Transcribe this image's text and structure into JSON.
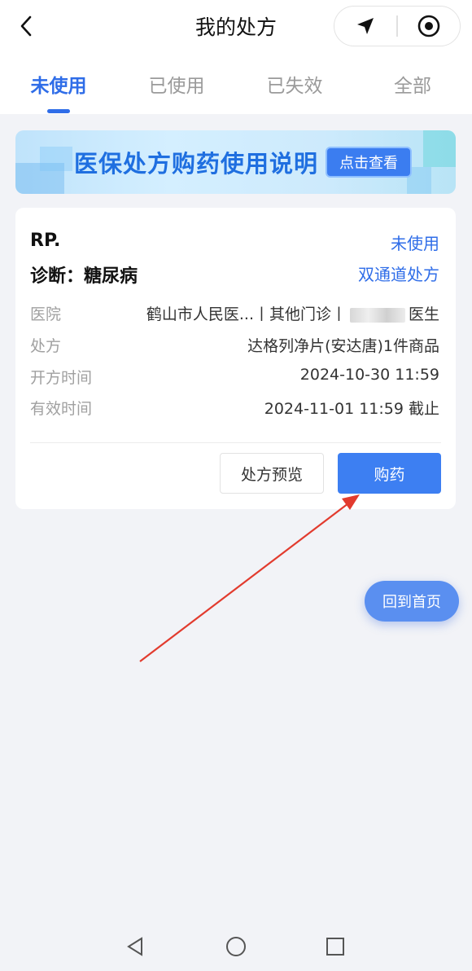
{
  "header": {
    "title": "我的处方",
    "back_icon": "chevron-left-icon",
    "capsule_icons": [
      "navigation-arrow-icon",
      "target-circle-icon"
    ]
  },
  "tabs": [
    {
      "label": "未使用",
      "active": true
    },
    {
      "label": "已使用",
      "active": false
    },
    {
      "label": "已失效",
      "active": false
    },
    {
      "label": "全部",
      "active": false
    }
  ],
  "banner": {
    "text": "医保处方购药使用说明",
    "button_label": "点击查看"
  },
  "card": {
    "rp": "RP.",
    "status": "未使用",
    "diagnosis": "诊断：糖尿病",
    "channel": "双通道处方",
    "rows": [
      {
        "label": "医院",
        "value_pre": "鹤山市人民医...丨其他门诊丨",
        "value_post": "医生"
      },
      {
        "label": "处方",
        "value": "达格列净片(安达唐)1件商品"
      },
      {
        "label": "开方时间",
        "value": "2024-10-30 11:59"
      },
      {
        "label": "有效时间",
        "value": "2024-11-01 11:59 截止"
      }
    ],
    "preview_label": "处方预览",
    "buy_label": "购药"
  },
  "home_button_label": "回到首页",
  "colors": {
    "accent": "#2f6de8",
    "buy_button": "#3d7ff2",
    "background": "#f2f3f7",
    "arrow": "#e23b2e"
  },
  "system_nav": [
    "back-triangle-icon",
    "home-circle-icon",
    "recents-square-icon"
  ]
}
